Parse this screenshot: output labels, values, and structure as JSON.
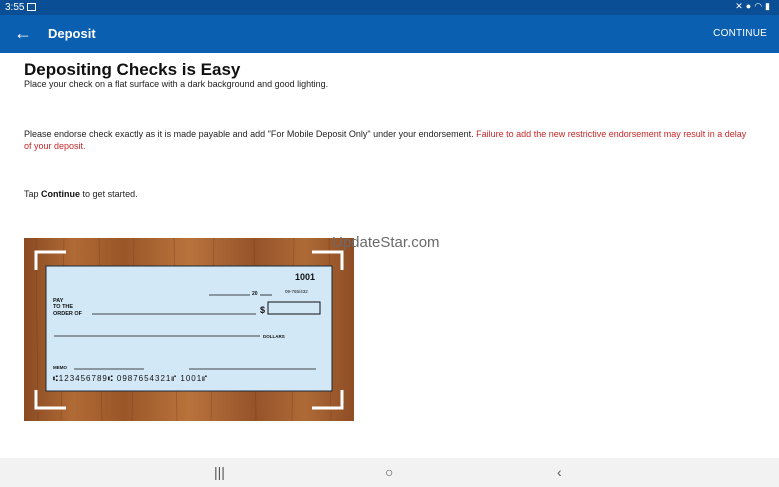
{
  "status": {
    "time": "3:55",
    "icons": [
      "image-icon",
      "mute-icon",
      "location-icon",
      "wifi-icon",
      "battery-icon"
    ]
  },
  "appbar": {
    "back_icon": "arrow-left-icon",
    "title": "Deposit",
    "continue_label": "CONTINUE"
  },
  "content": {
    "heading": "Depositing Checks is Easy",
    "instruction1": "Place your check on a flat surface with a dark background and good lighting.",
    "endorse_text": "Please endorse check exactly as it is made payable and add \"For Mobile Deposit Only\" under your endorsement.",
    "endorse_warning": "Failure to add the new restrictive endorsement may result in a delay of your deposit.",
    "tap_prefix": "Tap",
    "tap_bold": "Continue",
    "tap_suffix": "to get started."
  },
  "watermark": "UpdateStar.com",
  "check": {
    "number": "1001",
    "year_prefix": "20",
    "routing_fraction": "09-765/432",
    "pay_label": "PAY",
    "to_the_label": "TO THE",
    "order_of_label": "ORDER OF",
    "dollar_sign": "$",
    "dollars_label": "DOLLARS",
    "memo_label": "MEMO",
    "micr_line": "⑆123456789⑆ 0987654321⑈ 1001⑈"
  },
  "navbar": {
    "recents_icon": "|||",
    "home_icon": "○",
    "back_icon": "‹"
  },
  "colors": {
    "appbar": "#0b5fb0",
    "statusbar": "#0a4f96",
    "warning": "#c62828",
    "check_paper": "#d2e8f6"
  }
}
